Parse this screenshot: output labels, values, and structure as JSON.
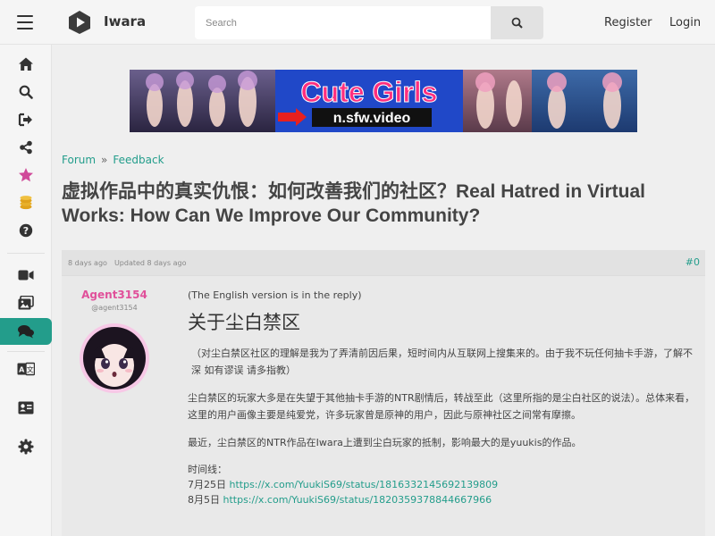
{
  "header": {
    "brand": "Iwara",
    "search_placeholder": "Search",
    "register_label": "Register",
    "login_label": "Login"
  },
  "sidebar": {
    "items": [
      {
        "icon": "home-icon"
      },
      {
        "icon": "search-icon"
      },
      {
        "icon": "login-icon"
      },
      {
        "icon": "share-icon"
      },
      {
        "icon": "star-icon",
        "color": "#d04a9a"
      },
      {
        "icon": "coins-icon",
        "color": "#e0a21c"
      },
      {
        "icon": "help-icon"
      },
      {
        "icon": "video-icon"
      },
      {
        "icon": "images-icon"
      },
      {
        "icon": "forum-icon",
        "active": true
      },
      {
        "icon": "translate-icon"
      },
      {
        "icon": "profile-card-icon"
      },
      {
        "icon": "settings-icon"
      }
    ]
  },
  "banner": {
    "title": "Cute Girls",
    "subtitle": "n.sfw.video"
  },
  "breadcrumb": {
    "forum": "Forum",
    "separator": "»",
    "section": "Feedback"
  },
  "page_title": "虚拟作品中的真实仇恨：如何改善我们的社区？Real Hatred in Virtual Works: How Can We Improve Our Community?",
  "post": {
    "created": "8 days ago",
    "updated": "Updated 8 days ago",
    "anchor": "#0",
    "author_name": "Agent3154",
    "author_handle": "@agent3154",
    "note": "(The English version is in the reply)",
    "heading": "关于尘白禁区",
    "para1": "（对尘白禁区社区的理解是我为了弄清前因后果，短时间内从互联网上搜集来的。由于我不玩任何抽卡手游，了解不深 如有谬误 请多指教）",
    "para2": "尘白禁区的玩家大多是在失望于其他抽卡手游的NTR剧情后，转战至此（这里所指的是尘白社区的说法）。总体来看，这里的用户画像主要是纯爱党，许多玩家曾是原神的用户，因此与原神社区之间常有摩擦。",
    "para3": "最近，尘白禁区的NTR作品在Iwara上遭到尘白玩家的抵制，影响最大的是yuukis的作品。",
    "timeline_label": "时间线：",
    "timeline": [
      {
        "date": "7月25日",
        "url": "https://x.com/YuukiS69/status/1816332145692139809"
      },
      {
        "date": "8月5日",
        "url": "https://x.com/YuukiS69/status/1820359378844667966"
      }
    ]
  },
  "colors": {
    "accent": "#239d8b",
    "author": "#e0509a",
    "banner_title": "#ff2e7e",
    "banner_arrow": "#e8201e"
  }
}
